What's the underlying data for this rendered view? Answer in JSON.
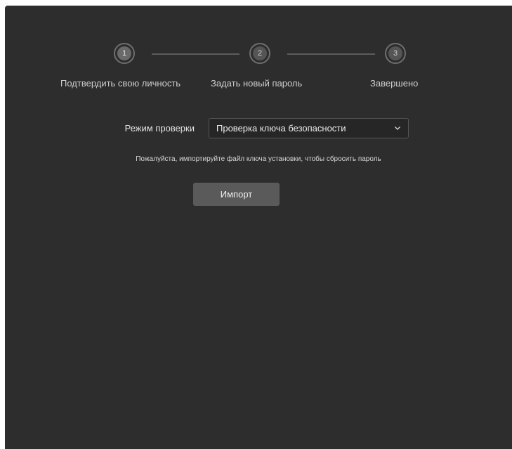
{
  "stepper": {
    "steps": [
      {
        "number": "1",
        "label": "Подтвердить свою личность"
      },
      {
        "number": "2",
        "label": "Задать новый пароль"
      },
      {
        "number": "3",
        "label": "Завершено"
      }
    ]
  },
  "verification": {
    "mode_label": "Режим проверки",
    "mode_selected": "Проверка ключа безопасности",
    "hint": "Пожалуйста, импортируйте файл ключа установки, чтобы сбросить пароль",
    "import_label": "Импорт"
  },
  "icons": {
    "dropdown": "chevron-down-icon"
  }
}
